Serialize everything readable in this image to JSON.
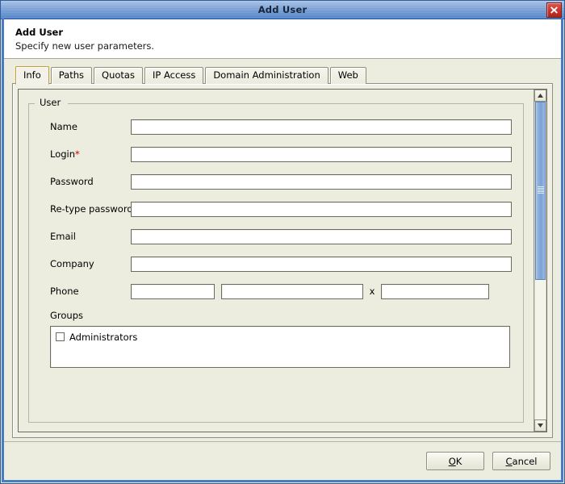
{
  "window": {
    "title": "Add User",
    "close_icon": "close-x-icon"
  },
  "header": {
    "title": "Add User",
    "subtitle": "Specify new user parameters."
  },
  "tabs": [
    {
      "label": "Info",
      "selected": true
    },
    {
      "label": "Paths",
      "selected": false
    },
    {
      "label": "Quotas",
      "selected": false
    },
    {
      "label": "IP Access",
      "selected": false
    },
    {
      "label": "Domain Administration",
      "selected": false
    },
    {
      "label": "Web",
      "selected": false
    }
  ],
  "group": {
    "title": "User"
  },
  "fields": {
    "name": {
      "label": "Name",
      "value": "",
      "placeholder": ""
    },
    "login": {
      "label": "Login",
      "required_marker": "*",
      "value": "",
      "placeholder": ""
    },
    "password": {
      "label": "Password",
      "value": "",
      "placeholder": ""
    },
    "retype_password": {
      "label": "Re-type password",
      "value": "",
      "placeholder": ""
    },
    "email": {
      "label": "Email",
      "value": "",
      "placeholder": ""
    },
    "company": {
      "label": "Company",
      "value": "",
      "placeholder": ""
    },
    "phone": {
      "label": "Phone",
      "area_value": "",
      "number_value": "",
      "separator": "x",
      "extension_value": ""
    },
    "groups": {
      "label": "Groups",
      "items": [
        {
          "label": "Administrators",
          "checked": false
        }
      ]
    }
  },
  "scrollbar": {
    "up_icon": "triangle-up-icon",
    "down_icon": "triangle-down-icon"
  },
  "buttons": {
    "ok": {
      "mnemonic": "O",
      "rest": "K"
    },
    "cancel": {
      "mnemonic": "C",
      "rest": "ancel"
    }
  },
  "colors": {
    "titlebar_top": "#a8c2e4",
    "titlebar_bottom": "#4f82c6",
    "frame_blue": "#4a7cc4",
    "panel_bg": "#ececdf",
    "selected_tab_border": "#c89b3c",
    "required_red": "#cc0000",
    "close_red": "#c9342b",
    "scroll_thumb_blue": "#8fb0dd"
  }
}
